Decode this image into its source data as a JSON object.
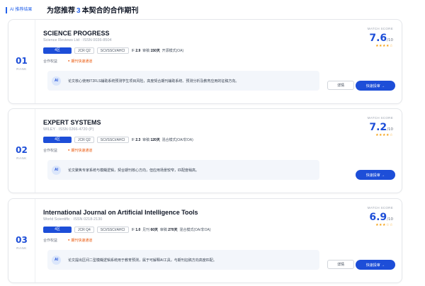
{
  "header": {
    "ai_badge": "AI 推荐结果",
    "headline_prefix": "为您推荐",
    "headline_count": "3",
    "headline_suffix": "本契合的合作期刊"
  },
  "common": {
    "rank_label": "RANK",
    "score_label": "MATCH SCORE",
    "score_out_of": "/10",
    "rights_label": "合作权益",
    "ai_icon": "AI",
    "detail_label": "详情",
    "submit_label": "快速投审 →"
  },
  "journals": [
    {
      "rank": "01",
      "title": "SCIENCE PROGRESS",
      "publisher": "Science Reviews Ltd · ISSN 0036-8504",
      "quartile_tag": "4区",
      "jcr": "JCR Q2",
      "index": "SCI/SSCI/AHCI",
      "if_label": "IF",
      "if_value": "2.9",
      "review_label": "审稿",
      "review_value": "150天",
      "access": "开源模式(OA)",
      "rights": "期刊快速通道",
      "ai_text": "论文核心使用IT2FLS辅助系统预测学生项目风险，高度契合期刊辅助系统、预测分析及教育应用的征稿方向。",
      "score": "7.6",
      "stars": "★★★★☆",
      "has_detail": true
    },
    {
      "rank": "02",
      "title": "EXPERT SYSTEMS",
      "publisher": "WILEY · ISSN 0266-4720 (P)",
      "quartile_tag": "4区",
      "jcr": "JCR Q2",
      "index": "SCI/SSCI/AHCI",
      "if_label": "IF",
      "if_value": "2.3",
      "review_label": "审稿",
      "review_value": "120天",
      "access": "混合模式(OA/非OA)",
      "rights": "期刊快速通道",
      "ai_text": "论文聚焦专家系统与模糊逻辑，契合期刊核心方向，但应用场景较窄，匹配度稍高。",
      "score": "7.2",
      "stars": "★★★★☆",
      "has_detail": false
    },
    {
      "rank": "03",
      "title": "International Journal on Artificial Intelligence Tools",
      "publisher": "World Scientific · ISSN 0218-2130",
      "quartile_tag": "4区",
      "jcr": "JCR Q4",
      "index": "SCI/SSCI/AHCI",
      "if_label": "IF",
      "if_value": "1.0",
      "accept_label": "见刊",
      "accept_value": "60天",
      "review_label": "审稿",
      "review_value": "270天",
      "access": "混合模式(OA/非OA)",
      "rights": "期刊快速通道",
      "ai_text": "论文提出区间二型模糊逻辑系统用于教育预测，属于可解释AI工具，与期刊征稿方向高度匹配。",
      "score": "6.9",
      "stars": "★★★☆☆",
      "has_detail": true
    }
  ]
}
